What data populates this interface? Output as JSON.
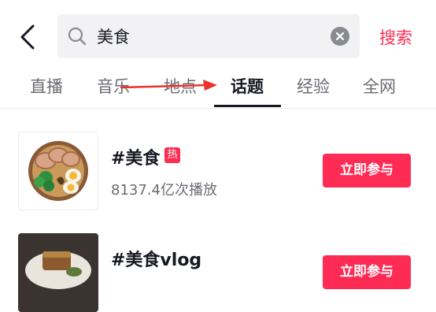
{
  "header": {
    "back_icon": "chevron-left-icon",
    "search_query": "美食",
    "search_button": "搜索",
    "accent_color": "#fe2c55"
  },
  "tabs": [
    {
      "label": "直播",
      "active": false
    },
    {
      "label": "音乐",
      "active": false
    },
    {
      "label": "地点",
      "active": false
    },
    {
      "label": "话题",
      "active": true
    },
    {
      "label": "经验",
      "active": false
    },
    {
      "label": "全网",
      "active": false
    }
  ],
  "results": [
    {
      "title": "#美食",
      "badge": "热",
      "plays": "8137.4亿次播放",
      "button": "立即参与"
    },
    {
      "title": "#美食vlog",
      "button": "立即参与"
    }
  ]
}
